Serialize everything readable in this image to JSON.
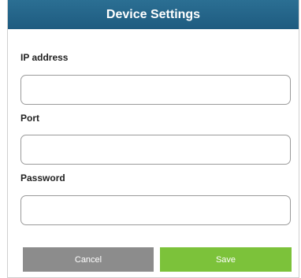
{
  "dialog": {
    "title": "Device Settings"
  },
  "fields": {
    "ip_address": {
      "label": "IP address",
      "value": "",
      "placeholder": ""
    },
    "port": {
      "label": "Port",
      "value": "",
      "placeholder": ""
    },
    "password": {
      "label": "Password",
      "value": "",
      "placeholder": ""
    }
  },
  "buttons": {
    "cancel_label": "Cancel",
    "save_label": "Save"
  },
  "colors": {
    "titlebar": "#1e5b80",
    "cancel": "#8c8c8c",
    "save": "#7cc23a"
  }
}
